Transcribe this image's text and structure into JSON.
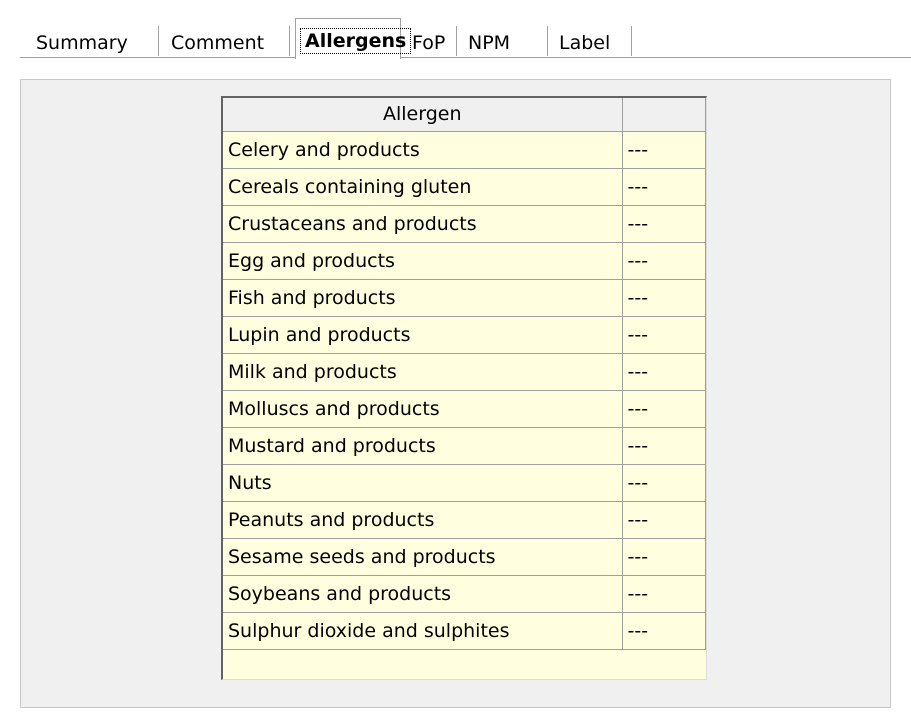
{
  "tabs": [
    {
      "label": "Summary",
      "active": false
    },
    {
      "label": "Comment",
      "active": false
    },
    {
      "label": "Allergens",
      "active": true
    },
    {
      "label": "FoP",
      "active": false
    },
    {
      "label": "NPM",
      "active": false
    },
    {
      "label": "Label",
      "active": false
    }
  ],
  "grid": {
    "columns": [
      "Allergen",
      ""
    ],
    "rows": [
      {
        "allergen": "Celery and products",
        "value": "---"
      },
      {
        "allergen": "Cereals containing gluten",
        "value": "---"
      },
      {
        "allergen": "Crustaceans and products",
        "value": "---"
      },
      {
        "allergen": "Egg and products",
        "value": "---"
      },
      {
        "allergen": "Fish and products",
        "value": "---"
      },
      {
        "allergen": "Lupin and products",
        "value": "---"
      },
      {
        "allergen": "Milk and products",
        "value": "---"
      },
      {
        "allergen": "Molluscs and products",
        "value": "---"
      },
      {
        "allergen": "Mustard and products",
        "value": "---"
      },
      {
        "allergen": "Nuts",
        "value": "---"
      },
      {
        "allergen": "Peanuts and products",
        "value": "---"
      },
      {
        "allergen": "Sesame seeds and products",
        "value": "---"
      },
      {
        "allergen": "Soybeans and products",
        "value": "---"
      },
      {
        "allergen": "Sulphur dioxide and sulphites",
        "value": "---"
      }
    ]
  },
  "colors": {
    "cell_background": "#ffffe0",
    "panel_background": "#f0f0f0",
    "header_background": "#f0f0f0"
  }
}
